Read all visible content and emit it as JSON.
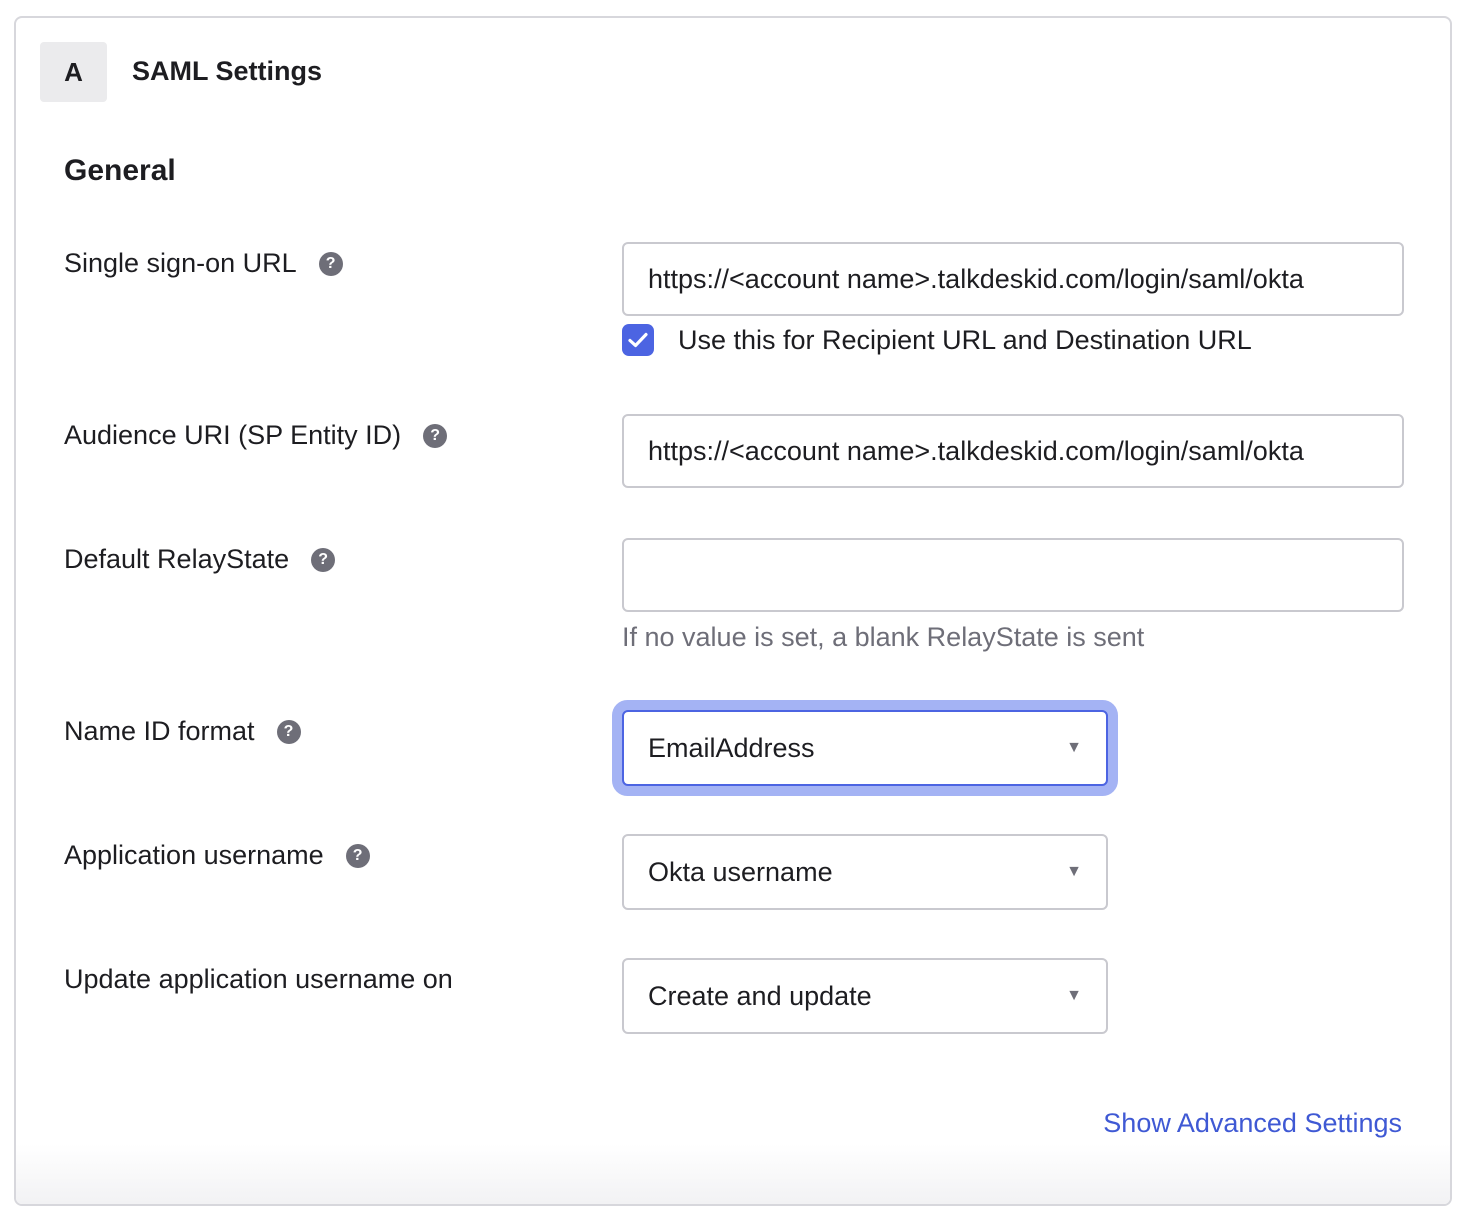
{
  "header": {
    "step_letter": "A",
    "title": "SAML Settings"
  },
  "section": {
    "title": "General"
  },
  "fields": {
    "sso_url": {
      "label": "Single sign-on URL",
      "value": "https://<account name>.talkdeskid.com/login/saml/okta"
    },
    "recipient_checkbox": {
      "label": "Use this for Recipient URL and Destination URL",
      "checked": true
    },
    "audience_uri": {
      "label": "Audience URI (SP Entity ID)",
      "value": "https://<account name>.talkdeskid.com/login/saml/okta"
    },
    "relay_state": {
      "label": "Default RelayState",
      "value": "",
      "hint": "If no value is set, a blank RelayState is sent"
    },
    "name_id_format": {
      "label": "Name ID format",
      "selected": "EmailAddress"
    },
    "app_username": {
      "label": "Application username",
      "selected": "Okta username"
    },
    "update_username": {
      "label": "Update application username on",
      "selected": "Create and update"
    }
  },
  "links": {
    "advanced": "Show Advanced Settings"
  },
  "icons": {
    "help": "?",
    "caret": "▼"
  },
  "colors": {
    "accent": "#4c64e2",
    "focus_ring": "#a4b3f4",
    "link": "#3f59d4"
  }
}
